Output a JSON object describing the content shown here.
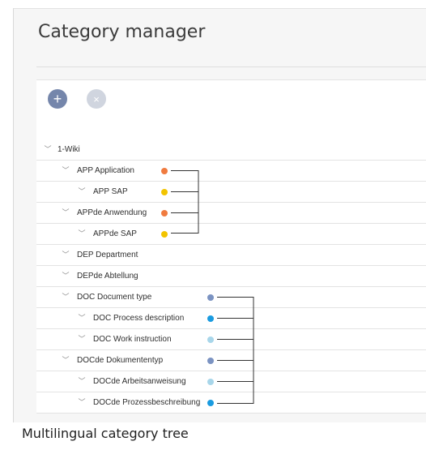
{
  "title": "Category manager",
  "toolbar": {
    "add_icon": "plus-icon",
    "cancel_icon": "close-icon",
    "add_glyph": "+",
    "cancel_glyph": "×"
  },
  "tree": {
    "chevron_glyph": "﹀",
    "rows": [
      {
        "label": "1-Wiki"
      },
      {
        "label": "APP Application",
        "color": "#f07b3f"
      },
      {
        "label": "APP SAP",
        "color": "#f2c400"
      },
      {
        "label": "APPde Anwendung",
        "color": "#f07b3f"
      },
      {
        "label": "APPde SAP",
        "color": "#f2c400"
      },
      {
        "label": "DEP Department"
      },
      {
        "label": "DEPde Abtellung"
      },
      {
        "label": "DOC Document type",
        "color": "#7b93c2"
      },
      {
        "label": "DOC Process description",
        "color": "#1a9be0"
      },
      {
        "label": "DOC Work instruction",
        "color": "#a8d6ea"
      },
      {
        "label": "DOCde Dokumententyp",
        "color": "#7b93c2"
      },
      {
        "label": "DOCde Arbeitsanweisung",
        "color": "#a8d6ea"
      },
      {
        "label": "DOCde Prozessbeschreibung",
        "color": "#1a9be0"
      }
    ]
  },
  "caption": "Multilingual category tree"
}
